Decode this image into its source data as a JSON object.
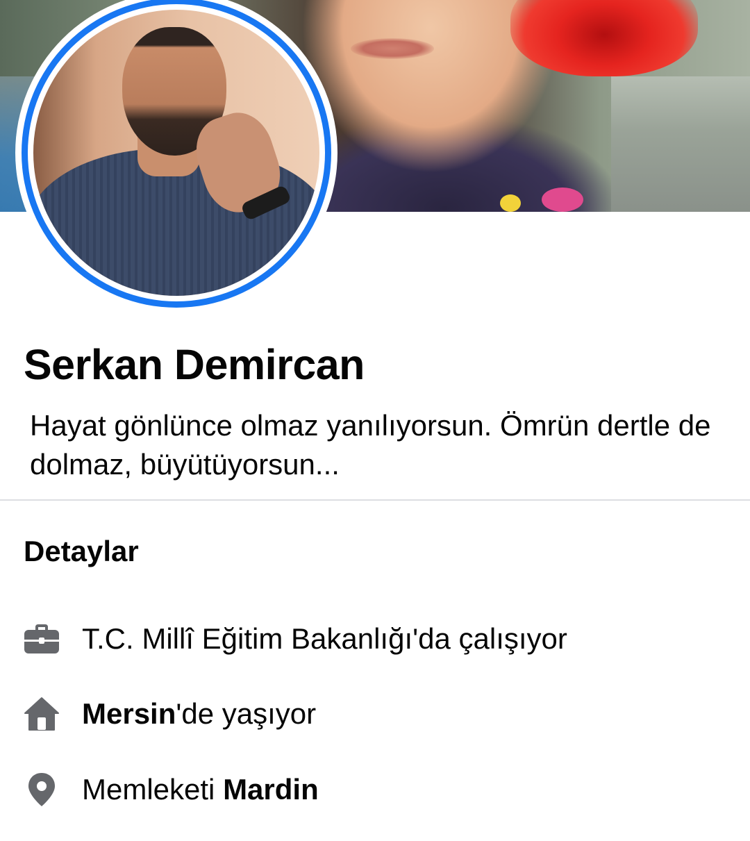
{
  "profile": {
    "name": "Serkan Demircan",
    "bio": "Hayat gönlünce olmaz yanılıyorsun. Ömrün dertle de dolmaz, büyütüyorsun..."
  },
  "details": {
    "title": "Detaylar",
    "work": {
      "icon": "briefcase-icon",
      "text": "T.C. Millî Eğitim Bakanlığı'da çalışıyor"
    },
    "lives": {
      "icon": "home-icon",
      "place": "Mersin",
      "suffix": "'de yaşıyor"
    },
    "hometown": {
      "icon": "location-pin-icon",
      "prefix": "Memleketi ",
      "place": "Mardin"
    }
  },
  "colors": {
    "accent": "#1877f2",
    "text": "#050505",
    "icon": "#65676b",
    "divider": "#dcdee2"
  }
}
